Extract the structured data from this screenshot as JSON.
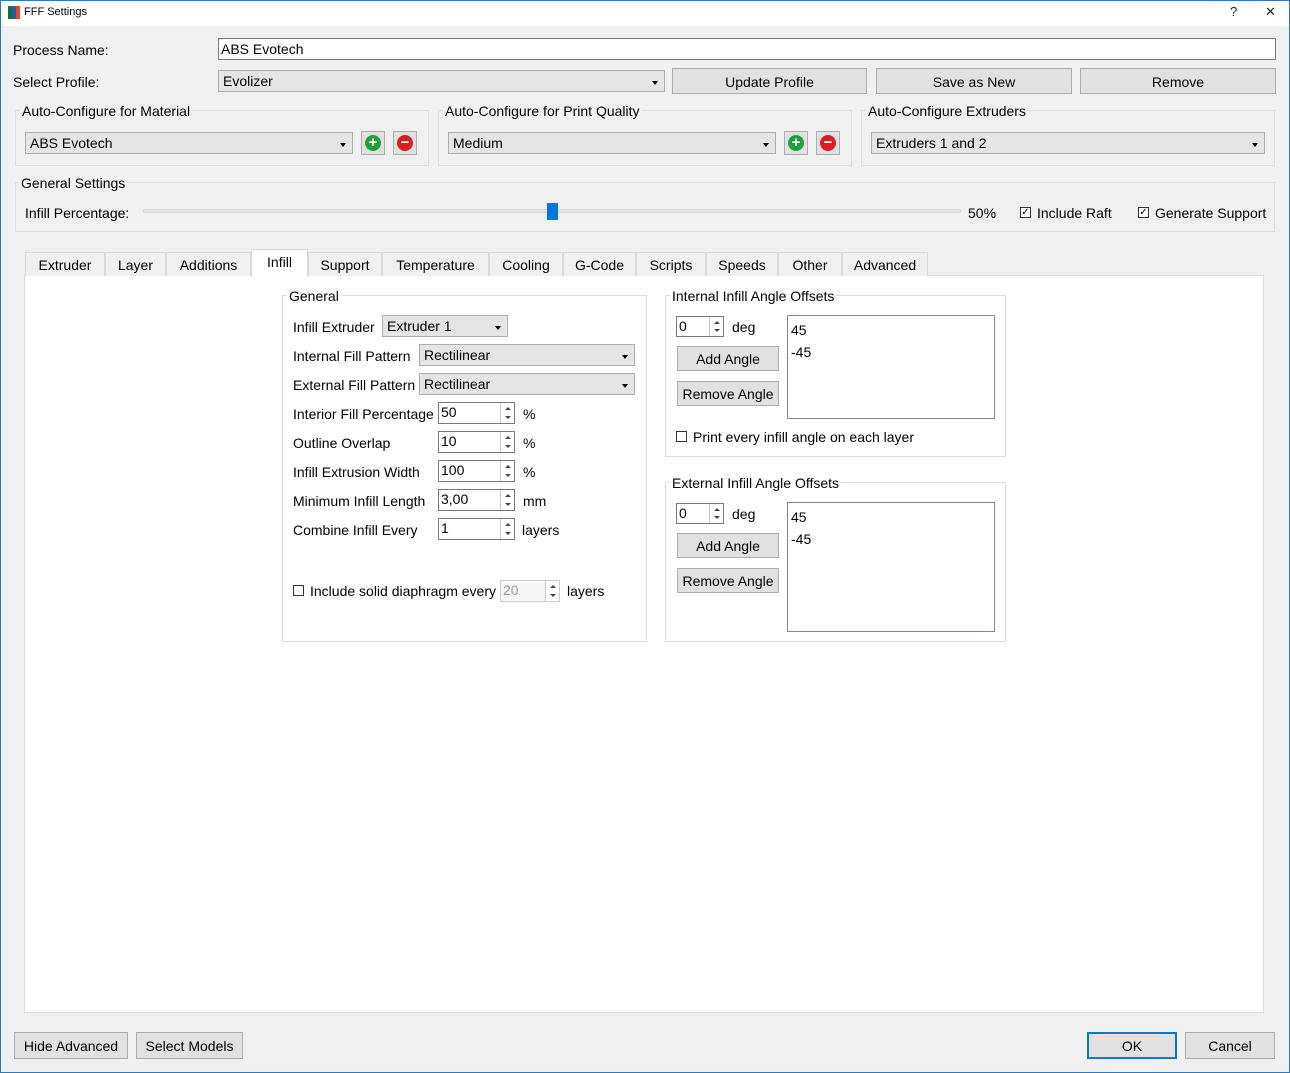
{
  "window": {
    "title": "FFF Settings",
    "help_glyph": "?",
    "close_glyph": "✕"
  },
  "process": {
    "label": "Process Name:",
    "value": "ABS Evotech"
  },
  "profile": {
    "label": "Select Profile:",
    "selected": "Evolizer",
    "update_label": "Update Profile",
    "save_new_label": "Save as New",
    "remove_label": "Remove"
  },
  "auto_material": {
    "title": "Auto-Configure for Material",
    "selected": "ABS Evotech"
  },
  "auto_quality": {
    "title": "Auto-Configure for Print Quality",
    "selected": "Medium"
  },
  "auto_extruders": {
    "title": "Auto-Configure Extruders",
    "selected": "Extruders 1 and 2"
  },
  "general_settings": {
    "title": "General Settings",
    "infill_label": "Infill Percentage:",
    "infill_value_text": "50%",
    "infill_fraction": 0.5,
    "raft_label": "Include Raft",
    "raft_checked": true,
    "support_label": "Generate Support",
    "support_checked": true
  },
  "tabs": [
    "Extruder",
    "Layer",
    "Additions",
    "Infill",
    "Support",
    "Temperature",
    "Cooling",
    "G-Code",
    "Scripts",
    "Speeds",
    "Other",
    "Advanced"
  ],
  "active_tab": "Infill",
  "infill_general": {
    "title": "General",
    "extruder_label": "Infill Extruder",
    "extruder_value": "Extruder 1",
    "internal_pattern_label": "Internal Fill Pattern",
    "internal_pattern_value": "Rectilinear",
    "external_pattern_label": "External Fill Pattern",
    "external_pattern_value": "Rectilinear",
    "interior_pct_label": "Interior Fill Percentage",
    "interior_pct_value": "50",
    "interior_pct_unit": "%",
    "outline_overlap_label": "Outline Overlap",
    "outline_overlap_value": "10",
    "outline_overlap_unit": "%",
    "extrusion_width_label": "Infill Extrusion Width",
    "extrusion_width_value": "100",
    "extrusion_width_unit": "%",
    "min_length_label": "Minimum Infill Length",
    "min_length_value": "3,00",
    "min_length_unit": "mm",
    "combine_label": "Combine Infill Every",
    "combine_value": "1",
    "combine_unit": "layers",
    "diaphragm_label": "Include solid diaphragm every",
    "diaphragm_value": "20",
    "diaphragm_unit": "layers",
    "diaphragm_checked": false
  },
  "internal_offsets": {
    "title": "Internal Infill Angle Offsets",
    "angle_value": "0",
    "unit": "deg",
    "add_label": "Add Angle",
    "remove_label": "Remove Angle",
    "angles": [
      "45",
      "-45"
    ],
    "print_every_label": "Print every infill angle on each layer",
    "print_every_checked": false
  },
  "external_offsets": {
    "title": "External Infill Angle Offsets",
    "angle_value": "0",
    "unit": "deg",
    "add_label": "Add Angle",
    "remove_label": "Remove Angle",
    "angles": [
      "45",
      "-45"
    ]
  },
  "footer": {
    "hide_advanced_label": "Hide Advanced",
    "select_models_label": "Select Models",
    "ok_label": "OK",
    "cancel_label": "Cancel"
  },
  "colors": {
    "accent": "#0078d7",
    "add": "#1ea13a",
    "remove": "#d81f26"
  }
}
